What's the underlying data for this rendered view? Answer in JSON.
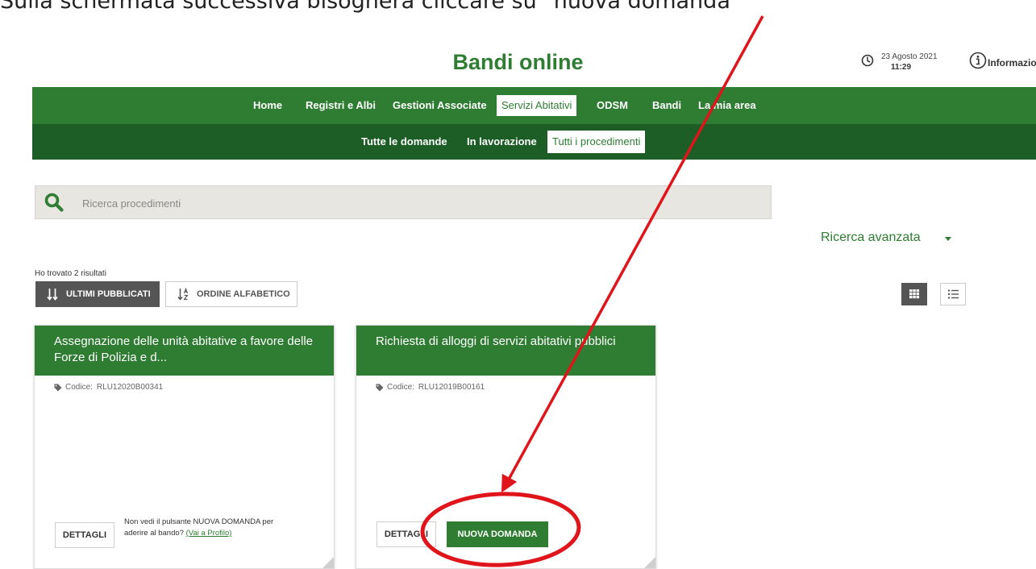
{
  "caption": "Sulla schermata successiva bisognerà cliccare su \"nuova domanda\"",
  "header": {
    "title": "Bandi online",
    "date": "23 Agosto 2021",
    "time": "11:29",
    "info_label": "Informazioni"
  },
  "main_nav": {
    "items": [
      "Home",
      "Registri e Albi",
      "Gestioni Associate",
      "Servizi Abitativi",
      "ODSM",
      "Bandi",
      "La mia area"
    ],
    "active": "Servizi Abitativi"
  },
  "sub_nav": {
    "items": [
      "Tutte le domande",
      "In lavorazione",
      "Tutti i procedimenti"
    ],
    "active": "Tutti i procedimenti"
  },
  "search": {
    "placeholder": "Ricerca procedimenti",
    "advanced_label": "Ricerca avanzata"
  },
  "results": {
    "count_text": "Ho trovato 2 risultati",
    "sort_latest": "ULTIMI PUBBLICATI",
    "sort_alpha": "ORDINE ALFABETICO"
  },
  "cards": [
    {
      "title": "Assegnazione delle unità abitative a favore delle Forze di Polizia e d...",
      "code_label": "Codice:",
      "code": "RLU12020B00341",
      "details_label": "DETTAGLI",
      "note": "Non vedi il pulsante NUOVA DOMANDA per aderire al bando?",
      "note_link": "(Vai a Profilo)"
    },
    {
      "title": "Richiesta di alloggi di servizi abitativi pubblici",
      "code_label": "Codice:",
      "code": "RLU12019B00161",
      "details_label": "DETTAGLI",
      "new_label": "NUOVA DOMANDA"
    }
  ],
  "colors": {
    "primary_green": "#2e7d32",
    "dark_green": "#1c5e26",
    "annotation_red": "#e0151b"
  }
}
